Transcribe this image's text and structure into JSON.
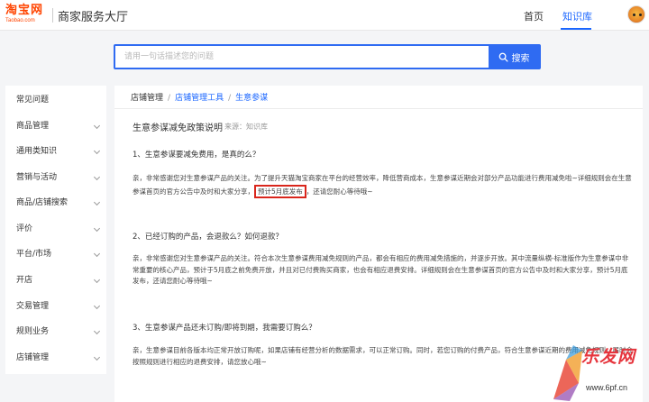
{
  "header": {
    "logo_cn": "淘宝网",
    "logo_en": "Taobao.com",
    "site_title": "商家服务大厅",
    "nav": {
      "home": "首页",
      "knowledge": "知识库"
    },
    "accent": "#1a66ff",
    "brand": "#ff4400"
  },
  "search": {
    "placeholder": "请用一句话描述您的问题",
    "button_label": "搜索"
  },
  "sidebar": {
    "items": [
      {
        "label": "常见问题",
        "expandable": false
      },
      {
        "label": "商品管理",
        "expandable": true
      },
      {
        "label": "通用类知识",
        "expandable": true
      },
      {
        "label": "营销与活动",
        "expandable": true
      },
      {
        "label": "商品/店铺搜索",
        "expandable": true
      },
      {
        "label": "评价",
        "expandable": true
      },
      {
        "label": "平台/市场",
        "expandable": true
      },
      {
        "label": "开店",
        "expandable": true
      },
      {
        "label": "交易管理",
        "expandable": true
      },
      {
        "label": "规则业务",
        "expandable": true
      },
      {
        "label": "店铺管理",
        "expandable": true
      }
    ]
  },
  "breadcrumb": {
    "root": "店铺管理",
    "level2": "店铺管理工具",
    "level3": "生意参谋"
  },
  "article": {
    "title": "生意参谋减免政策说明",
    "source": "来源：知识库",
    "q1": "1、生意参谋要减免费用，是真的么？",
    "a1_part1": "亲，非常感谢您对生意参谋产品的关注。为了提升天猫淘宝商家在平台的经营效率，降低营商成本，生意参谋近期会对部分产品功能进行费用减免啦~详细规则会在生意参谋首页的官方公告中及时和大家分享，",
    "a1_highlight": "预计5月底发布",
    "a1_part2": "，还请您耐心等待哦~",
    "q2": "2、已经订购的产品，会退款么？如何退款？",
    "a2": "亲，非常感谢您对生意参谋产品的关注。符合本次生意参谋费用减免规则的产品，都会有相应的费用减免措施的，并逐步开放。其中流量纵横-标准版作为生意参谋中非常重要的核心产品，预计于5月底之前免费开放，并且对已付费购买商家，也会有相应退费安排。详细规则会在生意参谋首页的官方公告中及时和大家分享，预计5月底发布，还请您耐心等待哦~",
    "q3": "3、生意参谋产品还未订购/即将到期，我需要订购么？",
    "a3": "亲，生意参谋目前各版本均正常开放订购呢，如果店铺有经营分析的数据需求，可以正常订购。同时，若您订购的付费产品，符合生意参谋近期的费用减免规则，届时会按照规则进行相应的退费安排，请您放心哦~",
    "highlight_color": "#d9261c"
  },
  "watermark": {
    "text": "乐发网",
    "url": "www.6pf.cn"
  }
}
